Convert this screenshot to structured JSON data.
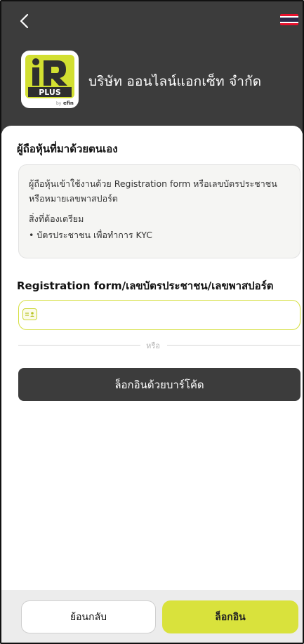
{
  "header": {
    "company_name": "บริษัท ออนไลน์แอกเซ็ท จำกัด",
    "language_flag": "thai-flag-icon",
    "logo": {
      "main": "iR",
      "sub": "PLUS",
      "by": "by",
      "brand": "efin"
    }
  },
  "section": {
    "title": "ผู้ถือหุ้นที่มาด้วยตนเอง"
  },
  "info": {
    "description": "ผู้ถือหุ้นเข้าใช้งานด้วย Registration form หรือเลขบัตรประชาชน หรือหมายเลขพาสปอร์ต",
    "prep_title": "สิ่งที่ต้องเตรียม",
    "prep_item": "• บัตรประชาชน เพื่อทำการ KYC"
  },
  "form": {
    "label": "Registration form/เลขบัตรประชาชน/เลขพาสปอร์ต",
    "value": "",
    "placeholder": "",
    "or_text": "หรือ"
  },
  "buttons": {
    "barcode_login": "ล็อกอินด้วยบาร์โค้ด",
    "back": "ย้อนกลับ",
    "login": "ล็อกอิน"
  },
  "colors": {
    "header_bg": "#3c3c3c",
    "accent": "#d9e23c",
    "flag_red": "#e8112d",
    "flag_blue": "#2d2a4a"
  }
}
